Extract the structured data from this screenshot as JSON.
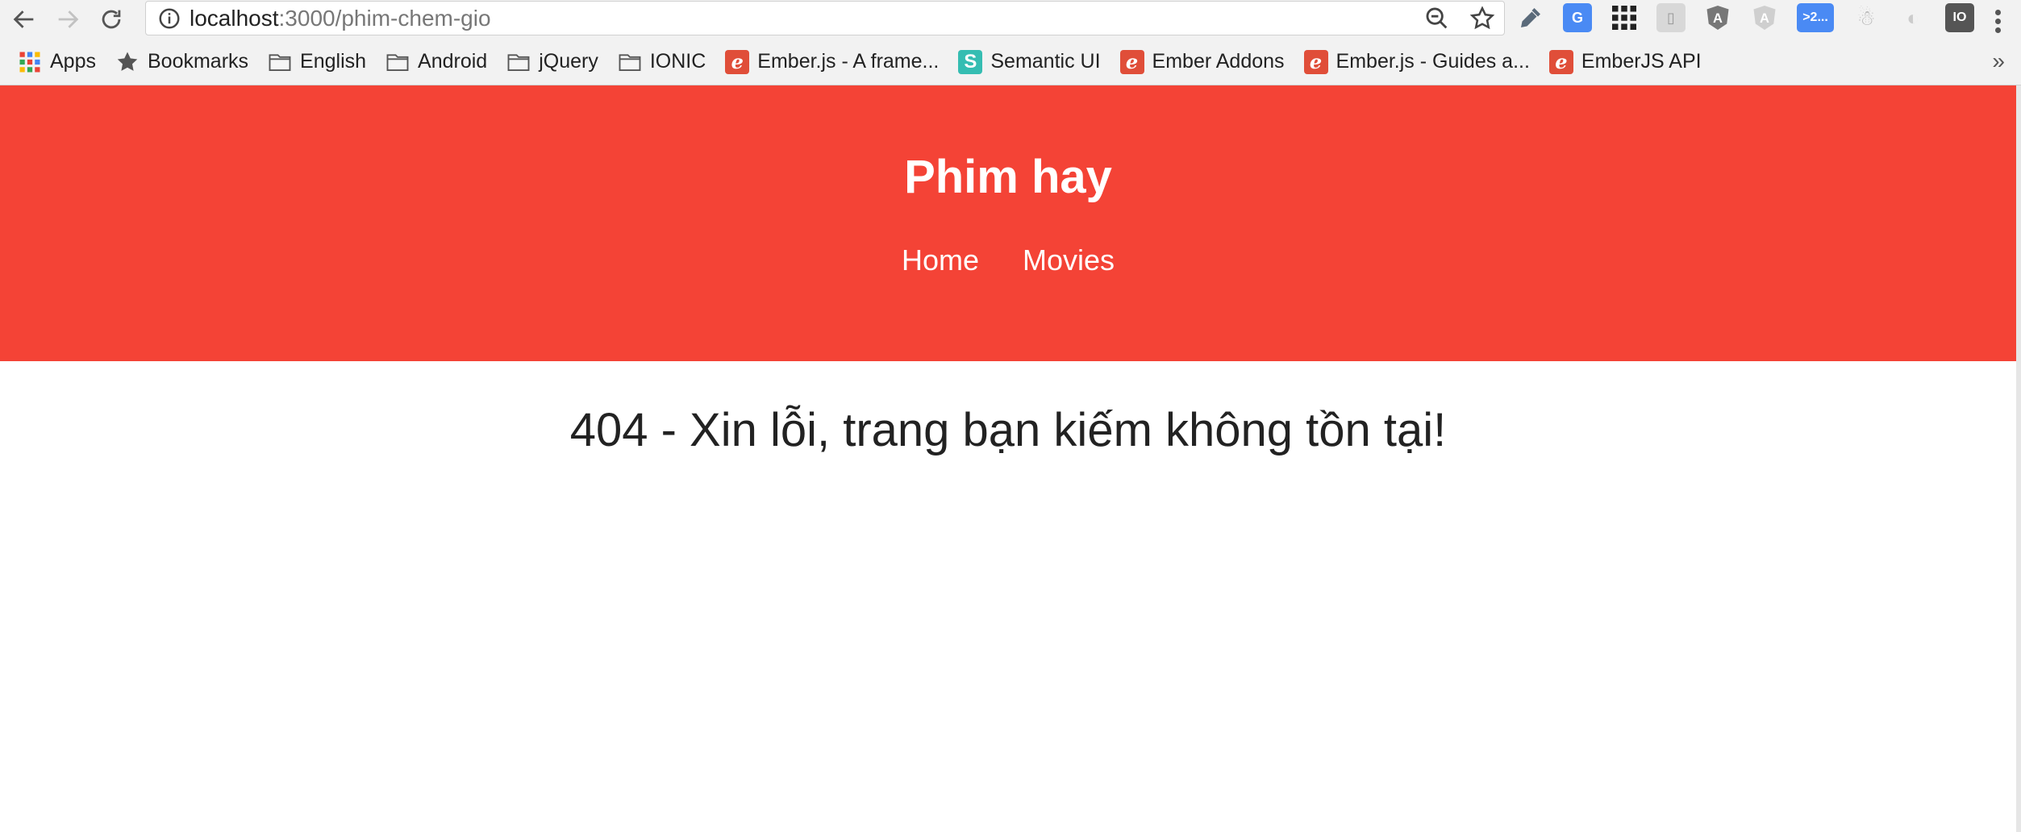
{
  "browser": {
    "url_host": "localhost",
    "url_path": ":3000/phim-chem-gio",
    "extension_badge": ">2..."
  },
  "bookmarks": [
    {
      "label": "Apps",
      "icon": "apps-grid-icon"
    },
    {
      "label": "Bookmarks",
      "icon": "star-icon"
    },
    {
      "label": "English",
      "icon": "folder-icon"
    },
    {
      "label": "Android",
      "icon": "folder-icon"
    },
    {
      "label": "jQuery",
      "icon": "folder-icon"
    },
    {
      "label": "IONIC",
      "icon": "folder-icon"
    },
    {
      "label": "Ember.js - A frame...",
      "icon": "ember-icon"
    },
    {
      "label": "Semantic UI",
      "icon": "semantic-icon"
    },
    {
      "label": "Ember Addons",
      "icon": "ember-icon"
    },
    {
      "label": "Ember.js - Guides a...",
      "icon": "ember-icon"
    },
    {
      "label": "EmberJS API",
      "icon": "ember-icon"
    }
  ],
  "site": {
    "title": "Phim hay",
    "nav": [
      {
        "label": "Home"
      },
      {
        "label": "Movies"
      }
    ]
  },
  "main": {
    "error_message": "404 - Xin lỗi, trang bạn kiếm không tồn tại!"
  },
  "colors": {
    "header_bg": "#f44336",
    "ember_red": "#e04e39",
    "semantic_teal": "#35bdb2"
  }
}
